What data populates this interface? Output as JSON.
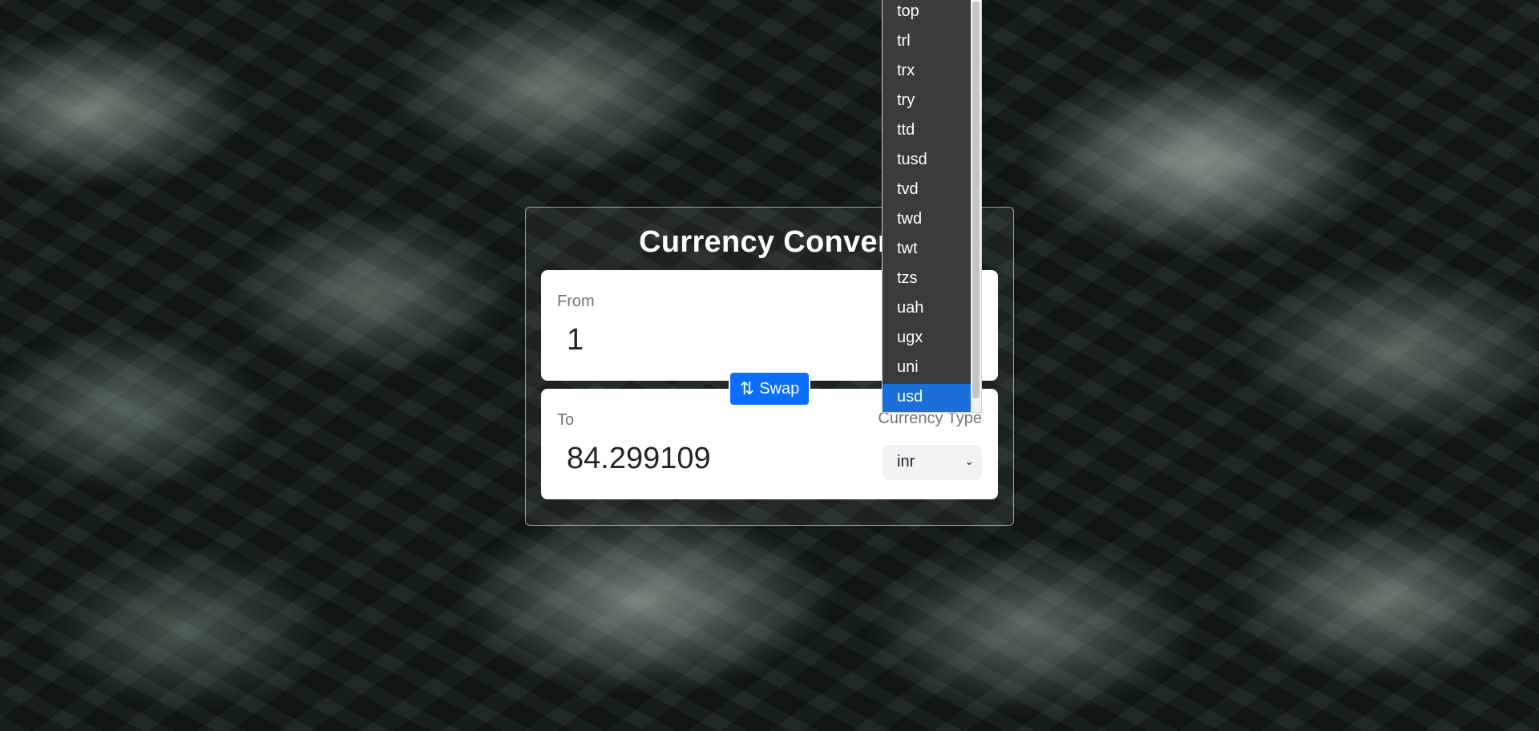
{
  "app": {
    "title": "Currency Converter",
    "title_visible": "Currency Convert"
  },
  "from": {
    "label": "From",
    "amount": "1"
  },
  "to": {
    "label": "To",
    "amount": "84.299109",
    "currency_type_label": "Currency Type",
    "selected_currency": "inr"
  },
  "swap": {
    "label": "Swap",
    "icon": "swap-vertical-arrows-icon"
  },
  "dropdown": {
    "options": [
      "top",
      "trl",
      "trx",
      "try",
      "ttd",
      "tusd",
      "tvd",
      "twd",
      "twt",
      "tzs",
      "uah",
      "ugx",
      "uni",
      "usd"
    ],
    "highlighted": "usd"
  },
  "colors": {
    "accent": "#0d6efd",
    "dropdown_bg": "#3b3b3b",
    "dropdown_highlight": "#1a6fd8"
  }
}
